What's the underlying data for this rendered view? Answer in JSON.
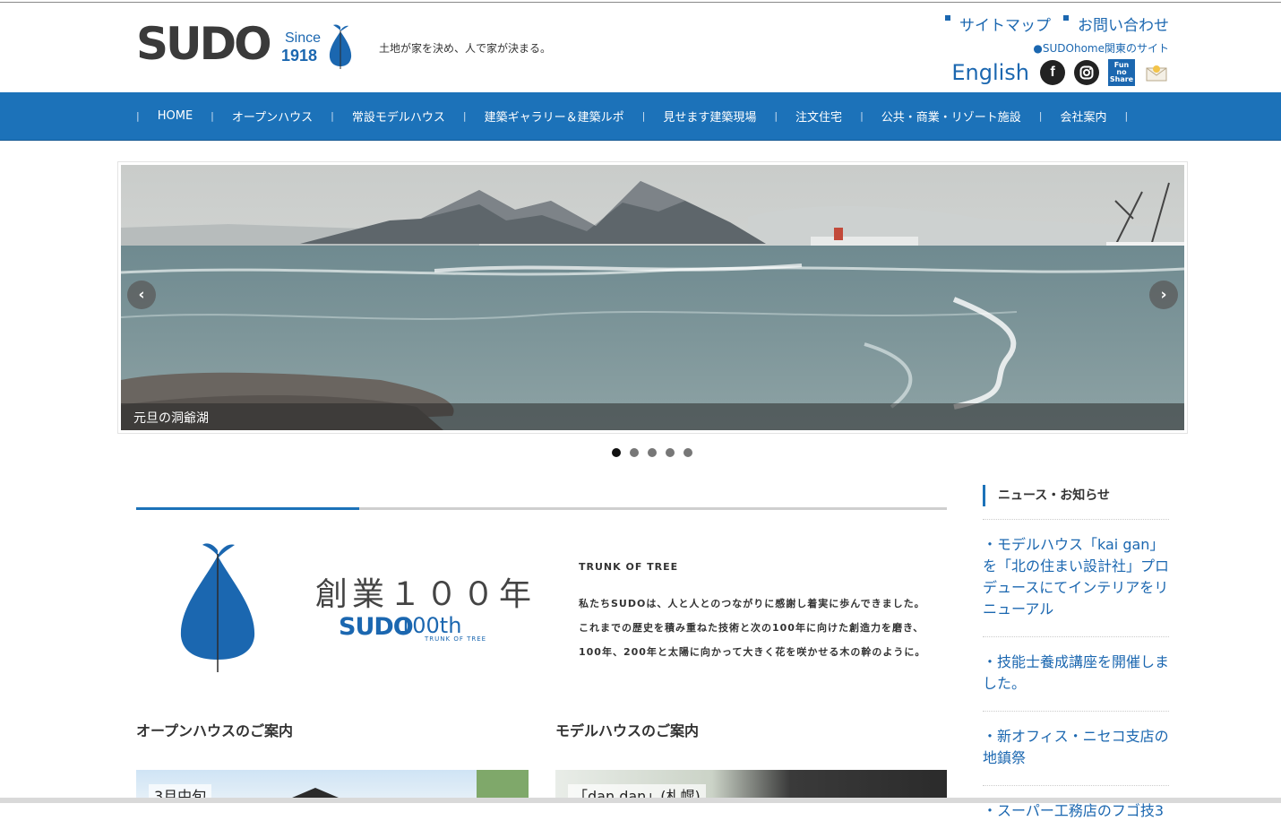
{
  "header": {
    "logo_text": "SUDO",
    "logo_since": "Since",
    "logo_year": "1918",
    "tagline": "土地が家を決め、人で家が決まる。",
    "links": [
      {
        "label": "サイトマップ"
      },
      {
        "label": "お問い合わせ"
      }
    ],
    "kanto_link": "●SUDOhome関東のサイト",
    "english_label": "English",
    "fun_share_label": "Fun no Share"
  },
  "nav": {
    "items": [
      {
        "label": "HOME"
      },
      {
        "label": "オープンハウス"
      },
      {
        "label": "常設モデルハウス"
      },
      {
        "label": "建築ギャラリー＆建築ルポ"
      },
      {
        "label": "見せます建築現場"
      },
      {
        "label": "注文住宅"
      },
      {
        "label": "公共・商業・リゾート施設"
      },
      {
        "label": "会社案内"
      }
    ]
  },
  "slider": {
    "caption": "元旦の洞爺湖",
    "prev_icon": "chevron-left-icon",
    "next_icon": "chevron-right-icon",
    "slide_count": 5,
    "active_index": 0
  },
  "centennial": {
    "title": "創業１００年",
    "brand": "SUDO",
    "anniversary": "100th",
    "anniversary_sub": "TRUNK OF TREE",
    "heading": "TRUNK OF TREE",
    "lines": [
      "私たちSUDOは、人と人とのつながりに感謝し着実に歩んできました。",
      "これまでの歴史を積み重ねた技術と次の100年に向けた創造力を磨き、",
      "100年、200年と太陽に向かって大きく花を咲かせる木の幹のように。"
    ]
  },
  "sections": {
    "open_house_title": "オープンハウスのご案内",
    "model_house_title": "モデルハウスのご案内",
    "open_house_card_label": "3月中旬",
    "model_house_card_label": "「dan dan」(札幌)"
  },
  "sidebar": {
    "heading": "ニュース・お知らせ",
    "news": [
      {
        "text": "・モデルハウス「kai gan」を「北の住まい設計社」プロデュースにてインテリアをリニューアル"
      },
      {
        "text": "・技能士養成講座を開催しました。"
      },
      {
        "text": "・新オフィス・ニセコ支店の地鎮祭"
      },
      {
        "text": "・スーパー工務店のフゴ技3"
      }
    ]
  },
  "colors": {
    "brand_blue": "#1c72b9",
    "nav_bg": "#1c72b9",
    "link_blue": "#1b67b0"
  }
}
